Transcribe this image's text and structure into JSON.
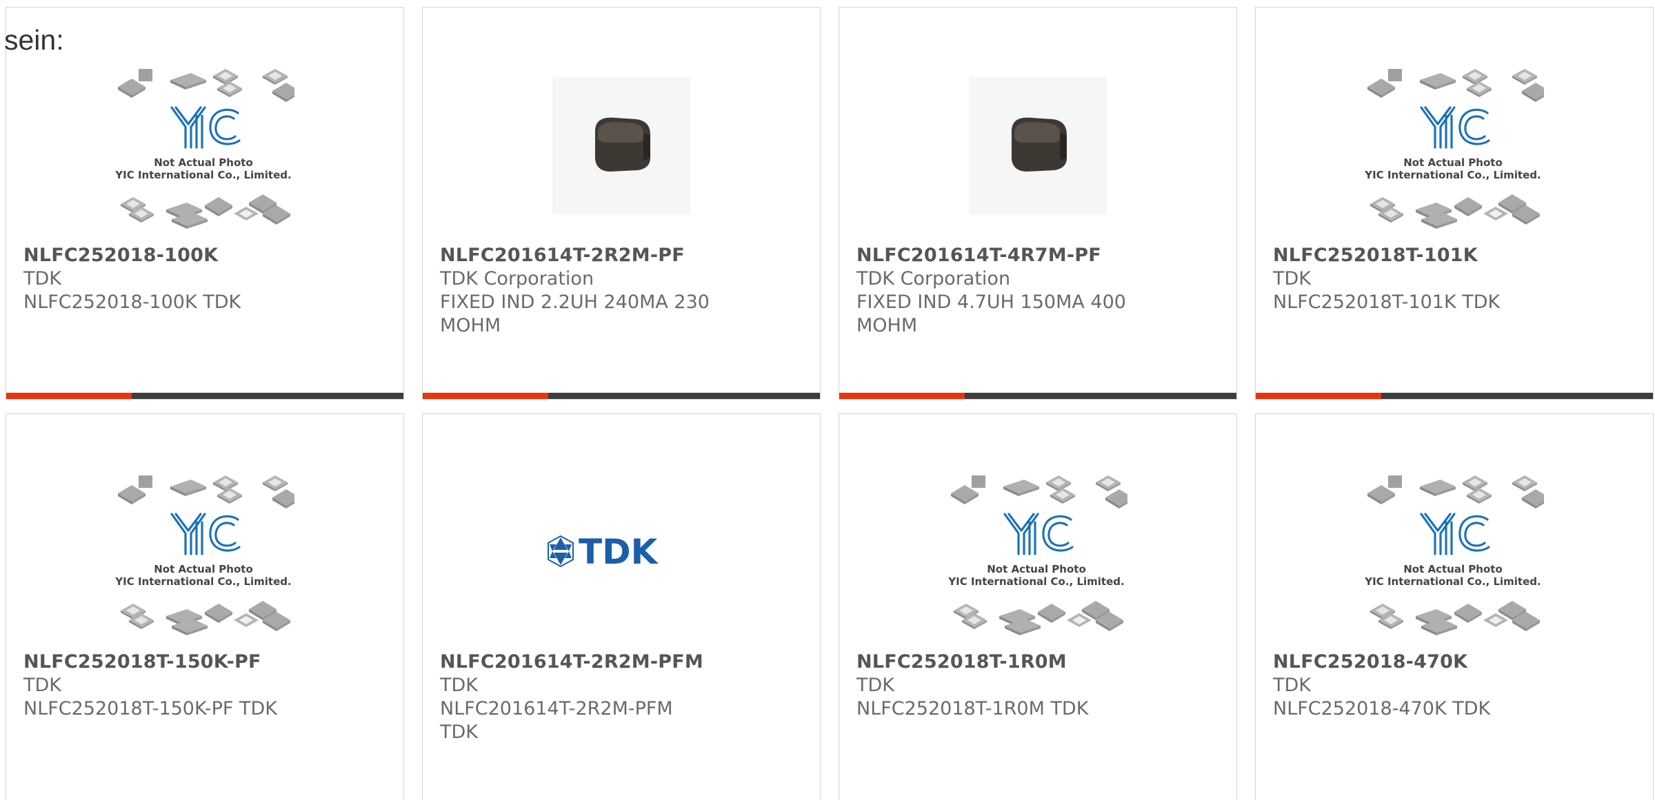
{
  "lead_text": "sein:",
  "colors": {
    "accent_bar": "#e8350e",
    "dark_bar": "#3d3d3d",
    "card_border": "#d4d4d4",
    "yic_blue": "#1d72b8",
    "tdk_blue": "#1b5fa9"
  },
  "placeholder_photo": {
    "line1": "Not Actual Photo",
    "line2": "YIC International Co., Limited."
  },
  "tdk_logo_text": "TDK",
  "products": [
    {
      "part_number": "NLFC252018-100K",
      "manufacturer": "TDK",
      "description": "NLFC252018-100K TDK",
      "image": "yic-placeholder"
    },
    {
      "part_number": "NLFC201614T-2R2M-PF",
      "manufacturer": "TDK Corporation",
      "description": "FIXED IND 2.2UH 240MA 230 MOHM",
      "image": "inductor-photo"
    },
    {
      "part_number": "NLFC201614T-4R7M-PF",
      "manufacturer": "TDK Corporation",
      "description": "FIXED IND 4.7UH 150MA 400 MOHM",
      "image": "inductor-photo"
    },
    {
      "part_number": "NLFC252018T-101K",
      "manufacturer": "TDK",
      "description": "NLFC252018T-101K TDK",
      "image": "yic-placeholder"
    },
    {
      "part_number": "NLFC252018T-150K-PF",
      "manufacturer": "TDK",
      "description": "NLFC252018T-150K-PF TDK",
      "image": "yic-placeholder"
    },
    {
      "part_number": "NLFC201614T-2R2M-PFM",
      "manufacturer": "TDK",
      "description": "NLFC201614T-2R2M-PFM TDK",
      "image": "tdk-logo"
    },
    {
      "part_number": "NLFC252018T-1R0M",
      "manufacturer": "TDK",
      "description": "NLFC252018T-1R0M TDK",
      "image": "yic-placeholder"
    },
    {
      "part_number": "NLFC252018-470K",
      "manufacturer": "TDK",
      "description": "NLFC252018-470K TDK",
      "image": "yic-placeholder"
    }
  ]
}
